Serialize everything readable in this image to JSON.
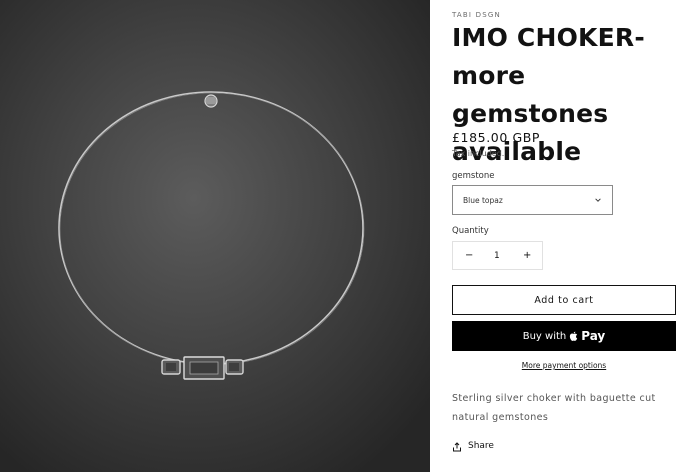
{
  "product": {
    "vendor": "TABI DSGN",
    "title_line1": "IMO CHOKER-",
    "title_line2": "more gemstones",
    "title_line3": "available",
    "price": "£185.00 GBP",
    "tax_note": "Tax included.",
    "description_line1": "Sterling silver choker with baguette cut",
    "description_line2": "natural gemstones"
  },
  "variant": {
    "label": "gemstone",
    "selected": "Blue topaz"
  },
  "quantity": {
    "label": "Quantity",
    "value": "1",
    "minus": "−",
    "plus": "+"
  },
  "actions": {
    "add_to_cart": "Add to cart",
    "buy_with": "Buy with",
    "pay_brand": "Pay",
    "more_payment_options": "More payment options",
    "share": "Share"
  },
  "icons": {
    "select_chevron": "chevron-down-icon",
    "apple_logo": "apple-icon",
    "share": "share-icon"
  },
  "colors": {
    "primary_button": "#000000",
    "text": "#121212",
    "photo_background": "#3a3a3a"
  }
}
